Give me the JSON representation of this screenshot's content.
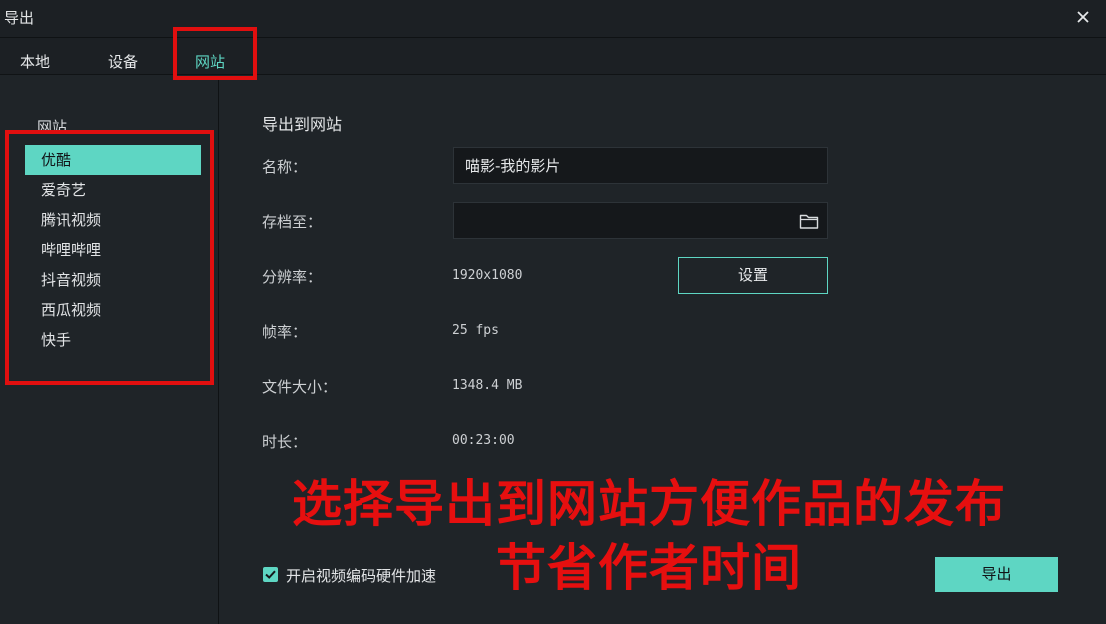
{
  "window": {
    "title": "导出",
    "close_icon": "close-icon"
  },
  "tabs": [
    {
      "label": "本地",
      "active": false
    },
    {
      "label": "设备",
      "active": false
    },
    {
      "label": "网站",
      "active": true
    }
  ],
  "sidebar": {
    "header": "网站",
    "items": [
      {
        "label": "优酷",
        "selected": true
      },
      {
        "label": "爱奇艺",
        "selected": false
      },
      {
        "label": "腾讯视频",
        "selected": false
      },
      {
        "label": "哔哩哔哩",
        "selected": false
      },
      {
        "label": "抖音视频",
        "selected": false
      },
      {
        "label": "西瓜视频",
        "selected": false
      },
      {
        "label": "快手",
        "selected": false
      }
    ]
  },
  "form": {
    "heading": "导出到网站",
    "name_label": "名称：",
    "name_value": "喵影-我的影片",
    "save_label": "存档至：",
    "save_path": "",
    "folder_icon": "folder-icon",
    "resolution_label": "分辨率：",
    "resolution_value": "1920x1080",
    "settings_button": "设置",
    "framerate_label": "帧率：",
    "framerate_value": "25 fps",
    "filesize_label": "文件大小：",
    "filesize_value": "1348.4 MB",
    "duration_label": "时长：",
    "duration_value": "00:23:00",
    "hw_accel_label": "开启视频编码硬件加速",
    "hw_accel_checked": true,
    "export_button": "导出"
  },
  "annotation": {
    "line1": "选择导出到网站方便作品的发布",
    "line2": "节省作者时间"
  },
  "colors": {
    "accent": "#5ed6c3",
    "background": "#1f2428",
    "annotation_red": "#e10f0f"
  }
}
